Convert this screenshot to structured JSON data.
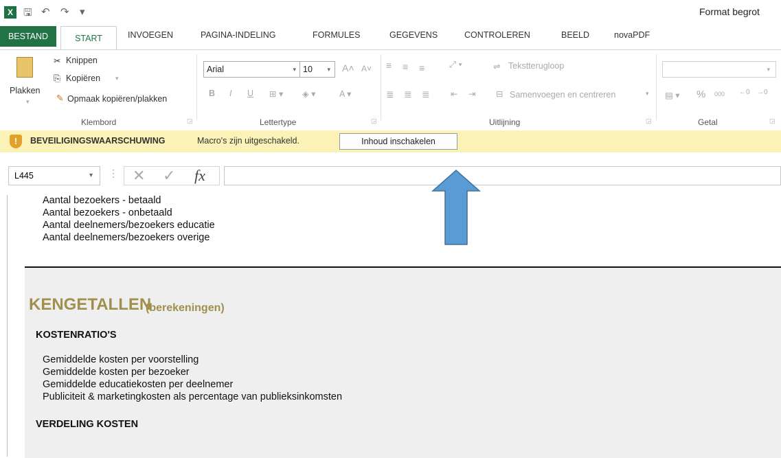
{
  "titlebar": {
    "app_icon": "X",
    "title": "Format begrot"
  },
  "tabs": [
    "BESTAND",
    "START",
    "INVOEGEN",
    "PAGINA-INDELING",
    "FORMULES",
    "GEGEVENS",
    "CONTROLEREN",
    "BEELD",
    "novaPDF"
  ],
  "ribbon": {
    "clipboard": {
      "paste": "Plakken",
      "cut": "Knippen",
      "copy": "Kopiëren",
      "format_painter": "Opmaak kopiëren/plakken",
      "group": "Klembord"
    },
    "font": {
      "name": "Arial",
      "size": "10",
      "bold": "B",
      "italic": "I",
      "underline": "U",
      "group": "Lettertype"
    },
    "alignment": {
      "wrap": "Tekstterugloop",
      "merge": "Samenvoegen en centreren",
      "group": "Uitlijning"
    },
    "number": {
      "percent": "%",
      "thousands": "000",
      "group": "Getal"
    }
  },
  "security": {
    "label": "BEVEILIGINGSWAARSCHUWING",
    "message": "Macro's zijn uitgeschakeld.",
    "button": "Inhoud inschakelen"
  },
  "formula_bar": {
    "cell_ref": "L445",
    "fx": "fx",
    "value": ""
  },
  "sheet": {
    "rows_top": [
      "Aantal bezoekers - betaald",
      "Aantal bezoekers - onbetaald",
      "Aantal deelnemers/bezoekers educatie",
      "Aantal deelnemers/bezoekers overige"
    ],
    "heading_main": "KENGETALLEN",
    "heading_sub": "(berekeningen)",
    "section1": "KOSTENRATIO'S",
    "section1_rows": [
      "Gemiddelde kosten per voorstelling",
      "Gemiddelde kosten per bezoeker",
      "Gemiddelde educatiekosten per deelnemer",
      "Publiciteit & marketingkosten als percentage van publieksinkomsten"
    ],
    "section2": "VERDELING KOSTEN"
  }
}
